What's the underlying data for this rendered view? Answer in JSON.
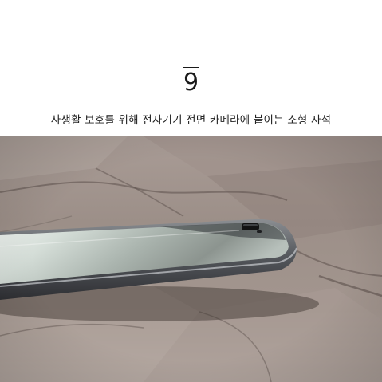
{
  "page": {
    "number": "9",
    "caption": "사생활 보호를 위해 전자기기 전면 카메라에 붙이는 소형 자석"
  },
  "photo": {
    "subject": "smartphone-on-stone-floor",
    "colors": {
      "stone_light": "#b8aca6",
      "stone_dark": "#6e625e",
      "phone_body": "#5a5c60",
      "screen": "#c9d3ce"
    }
  }
}
